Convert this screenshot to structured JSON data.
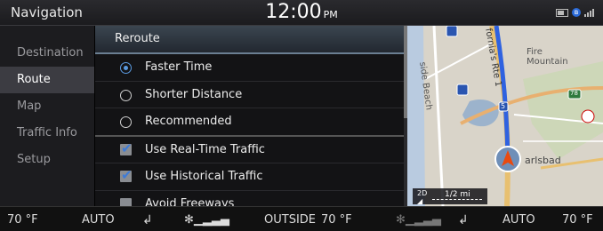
{
  "statusbar": {
    "title": "Navigation",
    "time": "12:00",
    "ampm": "PM"
  },
  "left_menu": {
    "items": [
      {
        "label": "Destination",
        "active": false
      },
      {
        "label": "Route",
        "active": true
      },
      {
        "label": "Map",
        "active": false
      },
      {
        "label": "Traffic Info",
        "active": false
      },
      {
        "label": "Setup",
        "active": false
      }
    ]
  },
  "list": {
    "header": "Reroute",
    "options": [
      {
        "label": "Faster Time",
        "type": "radio",
        "selected": true
      },
      {
        "label": "Shorter Distance",
        "type": "radio",
        "selected": false
      },
      {
        "label": "Recommended",
        "type": "radio",
        "selected": false
      },
      {
        "label": "Use Real-Time Traffic",
        "type": "checkbox",
        "checked": true
      },
      {
        "label": "Use Historical Traffic",
        "type": "checkbox",
        "checked": true
      },
      {
        "label": "Avoid Freeways",
        "type": "checkbox",
        "checked": false
      }
    ]
  },
  "map": {
    "labels": {
      "fire_mountain": "Fire\nMountain",
      "carlsbad": "arlsbad",
      "street_left": "side Beach",
      "street_top": "fornia's Rte 1",
      "route_number_1": "5",
      "route_number_2": "78"
    },
    "view_mode": "2D",
    "scale": "1/2 mi"
  },
  "climate": {
    "left_temp": "70 °F",
    "left_mode": "AUTO",
    "outside_label": "OUTSIDE",
    "outside_temp": "70 °F",
    "right_mode": "AUTO",
    "right_temp": "70 °F"
  },
  "colors": {
    "accent_blue": "#3e7bd6",
    "route_blue": "#2f62e0",
    "map_bg": "#d9d4c9",
    "water": "#9cb3cc"
  }
}
